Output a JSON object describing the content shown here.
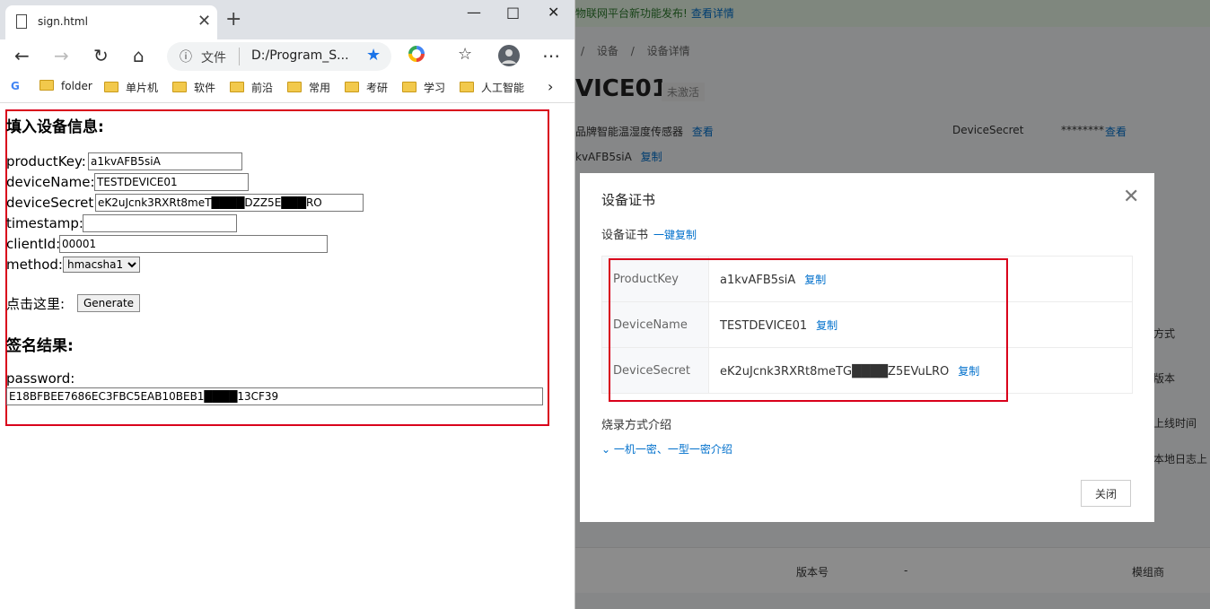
{
  "browser": {
    "tab_title": "sign.html",
    "address_label": "文件",
    "url": "D:/Program_S...",
    "bookmarks": [
      "folder",
      "单片机",
      "软件",
      "前沿",
      "常用",
      "考研",
      "学习",
      "人工智能"
    ]
  },
  "form": {
    "heading": "填入设备信息:",
    "fields": [
      {
        "label": "productKey:",
        "value": "a1kvAFB5siA"
      },
      {
        "label": "deviceName:",
        "value": "TESTDEVICE01"
      },
      {
        "label": "deviceSecret:",
        "value": "eK2uJcnk3RXRt8meT████DZZ5E███RO"
      },
      {
        "label": "timestamp:",
        "value": ""
      },
      {
        "label": "clientId:",
        "value": "00001"
      }
    ],
    "method_label": "method:",
    "method_value": "hmacsha1",
    "click_label": "点击这里:",
    "generate_label": "Generate",
    "result_heading": "签名结果:",
    "password_label": "password:",
    "password_value": "E18BFBEE7686EC3FBC5EAB10BEB1████13CF39"
  },
  "console": {
    "banner": "物联网平台新功能发布!",
    "banner_link": "查看详情",
    "breadcrumb": [
      "/",
      "设备",
      "/",
      "设备详情"
    ],
    "device_title": "VICE01",
    "device_status": "未激活",
    "product_text": "品牌智能温湿度传感器",
    "view_link": "查看",
    "secret_label": "DeviceSecret",
    "secret_value": "********",
    "secret_view": "查看",
    "pk_text": "kvAFB5siA",
    "copy_link": "复制",
    "side_labels": [
      "方式",
      "版本",
      "上线时间",
      "本地日志上"
    ],
    "table_headers": [
      "版本号",
      "-",
      "模组商"
    ]
  },
  "modal": {
    "title": "设备证书",
    "subtitle": "设备证书",
    "copy_all": "一键复制",
    "rows": [
      {
        "key": "ProductKey",
        "value": "a1kvAFB5siA",
        "copy": "复制"
      },
      {
        "key": "DeviceName",
        "value": "TESTDEVICE01",
        "copy": "复制"
      },
      {
        "key": "DeviceSecret",
        "value": "eK2uJcnk3RXRt8meTG████Z5EVuLRO",
        "copy": "复制"
      }
    ],
    "burn_title": "烧录方式介绍",
    "intro_link": "一机一密、一型一密介绍",
    "close_button": "关闭"
  },
  "colors": {
    "accent": "#0070cc",
    "highlight_box": "#d9001b"
  }
}
